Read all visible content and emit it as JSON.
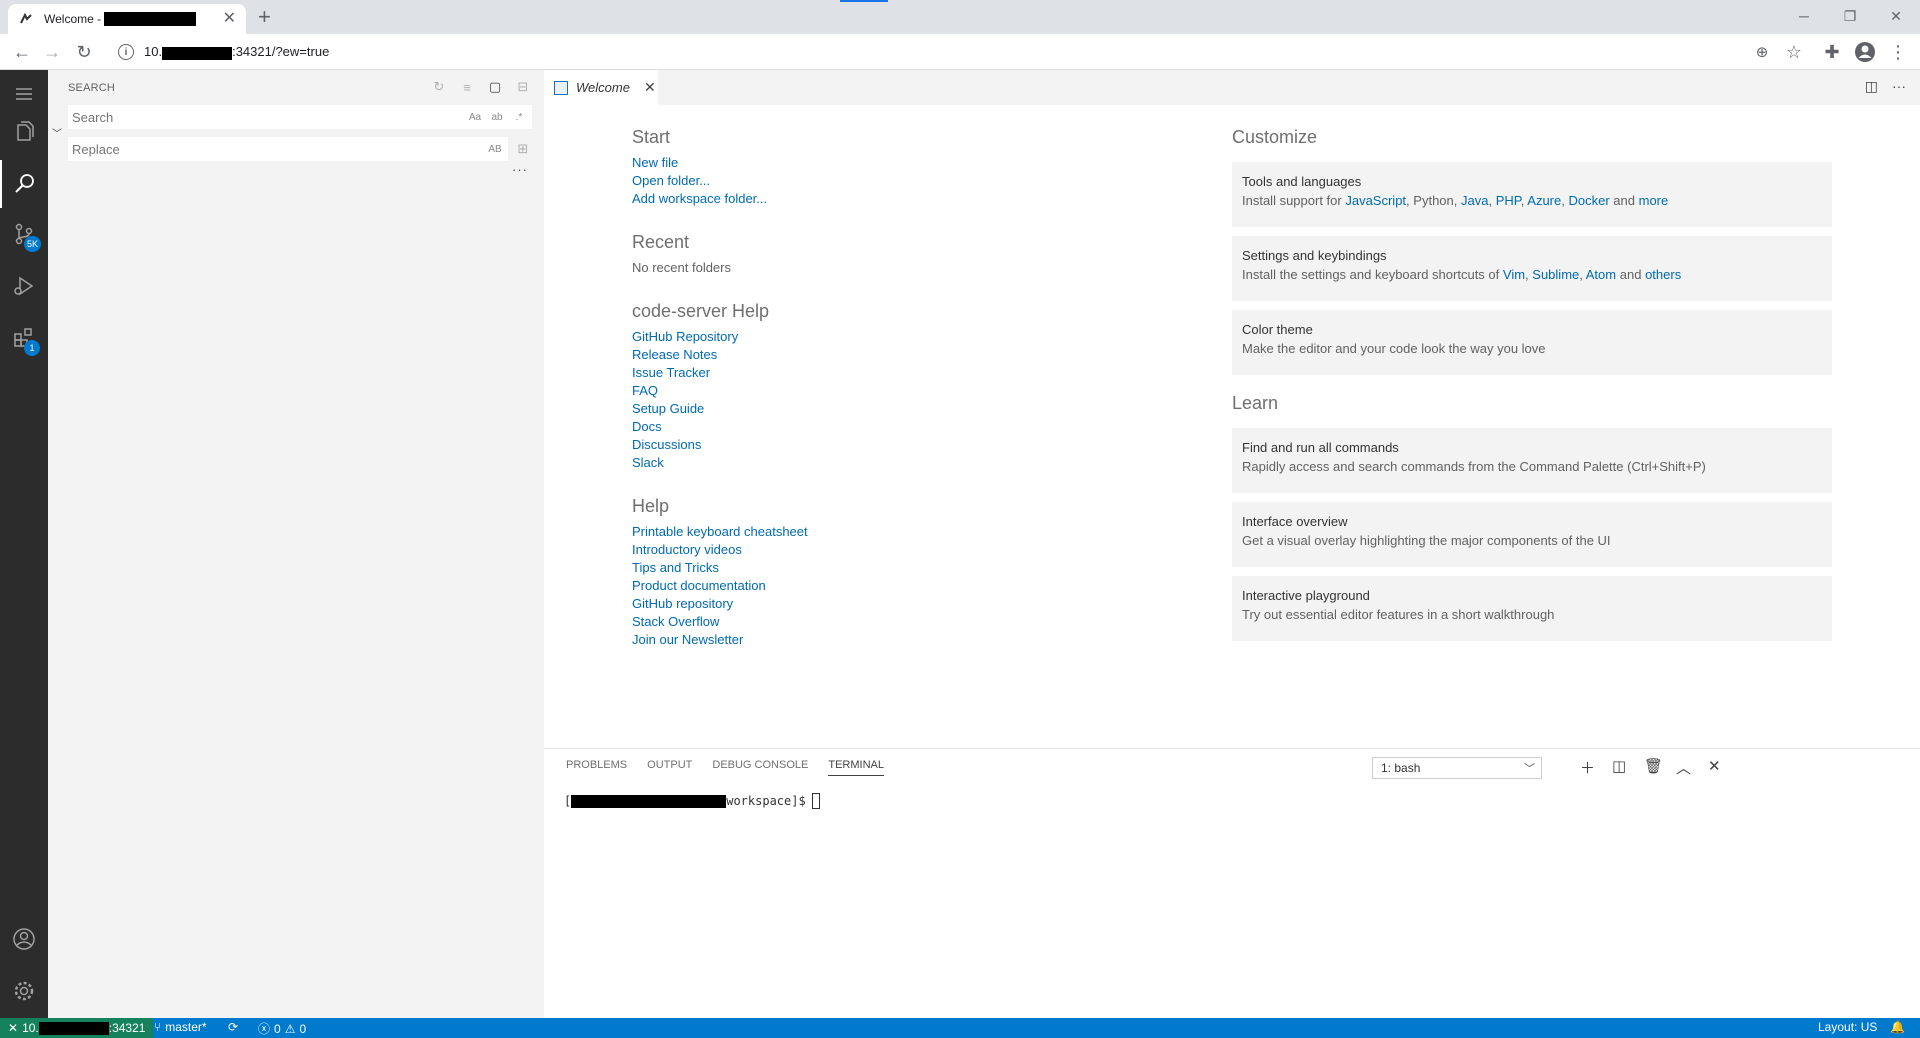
{
  "browser": {
    "tab_title_prefix": "Welcome -",
    "new_tab": "+",
    "close_tab": "✕",
    "url_prefix": "10.",
    "url_suffix": ":34321/?ew=true",
    "window_min": "─",
    "window_restore": "❐",
    "window_close": "✕"
  },
  "sidebar": {
    "title": "SEARCH",
    "search_placeholder": "Search",
    "replace_placeholder": "Replace",
    "match_case": "Aa",
    "whole_word": "ab",
    "regex": ".*",
    "preserve_case": "AB",
    "more": "···"
  },
  "activity": {
    "scm_badge": "5K",
    "ext_badge": "1"
  },
  "editor": {
    "tab_label": "Welcome",
    "tab_close": "✕"
  },
  "welcome": {
    "start": {
      "title": "Start",
      "links": [
        "New file",
        "Open folder...",
        "Add workspace folder..."
      ]
    },
    "recent": {
      "title": "Recent",
      "empty": "No recent folders"
    },
    "help_cs": {
      "title": "code-server Help",
      "links": [
        "GitHub Repository",
        "Release Notes",
        "Issue Tracker",
        "FAQ",
        "Setup Guide",
        "Docs",
        "Discussions",
        "Slack"
      ]
    },
    "help": {
      "title": "Help",
      "links": [
        "Printable keyboard cheatsheet",
        "Introductory videos",
        "Tips and Tricks",
        "Product documentation",
        "GitHub repository",
        "Stack Overflow",
        "Join our Newsletter"
      ]
    },
    "customize": {
      "title": "Customize",
      "tools_title": "Tools and languages",
      "tools_desc_prefix": "Install support for",
      "tools_links": [
        "JavaScript",
        "Python",
        "Java",
        "PHP",
        "Azure",
        "Docker"
      ],
      "tools_and": "and",
      "tools_more": "more",
      "settings_title": "Settings and keybindings",
      "settings_desc_prefix": "Install the settings and keyboard shortcuts of",
      "settings_links": [
        "Vim",
        "Sublime",
        "Atom"
      ],
      "settings_and": "and",
      "settings_others": "others",
      "theme_title": "Color theme",
      "theme_desc": "Make the editor and your code look the way you love"
    },
    "learn": {
      "title": "Learn",
      "cmd_title": "Find and run all commands",
      "cmd_desc": "Rapidly access and search commands from the Command Palette (Ctrl+Shift+P)",
      "iface_title": "Interface overview",
      "iface_desc": "Get a visual overlay highlighting the major components of the UI",
      "play_title": "Interactive playground",
      "play_desc": "Try out essential editor features in a short walkthrough"
    }
  },
  "panel": {
    "tabs": [
      "PROBLEMS",
      "OUTPUT",
      "DEBUG CONSOLE",
      "TERMINAL"
    ],
    "terminal_select": "1: bash",
    "prompt_prefix": "[",
    "prompt_suffix": "workspace]$"
  },
  "status": {
    "remote_prefix": "10.",
    "remote_suffix": ":34321",
    "branch": "master*",
    "errors": "0",
    "warnings": "0",
    "layout": "Layout: US"
  },
  "colors": {
    "accent": "#007acc",
    "link": "#006ab1",
    "remote": "#16825d"
  }
}
